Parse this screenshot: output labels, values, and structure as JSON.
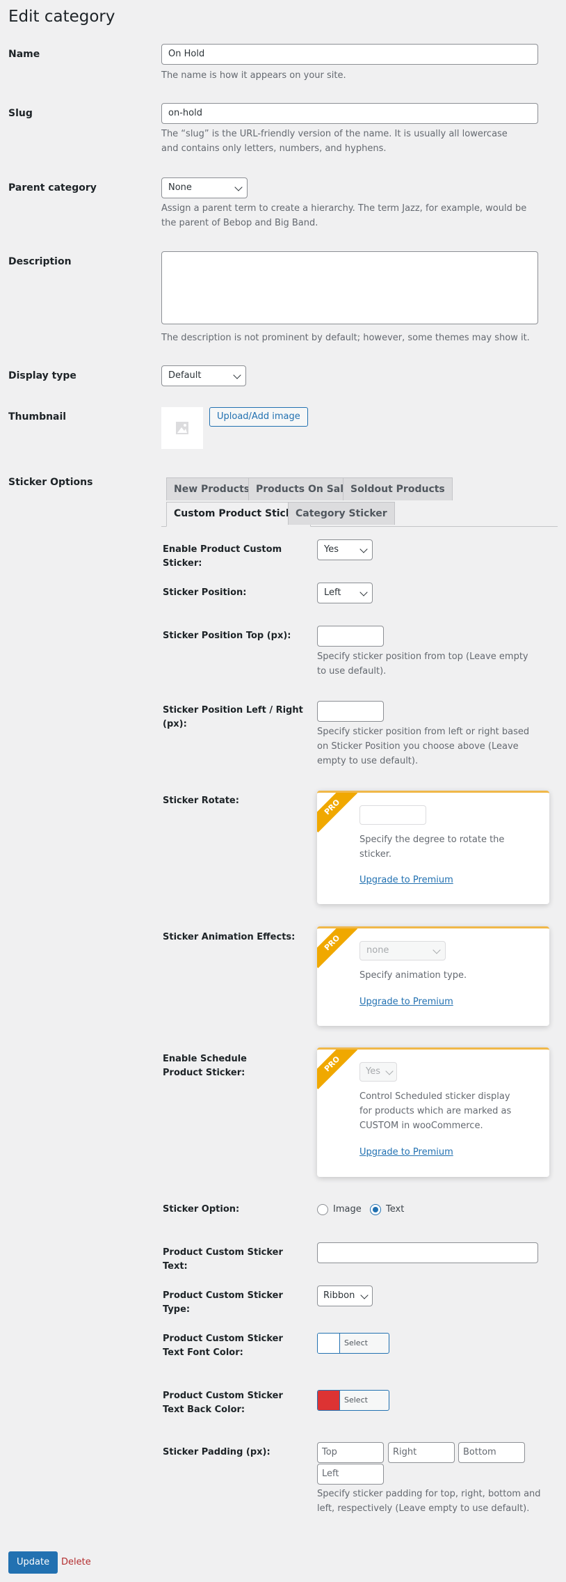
{
  "page_title": "Edit category",
  "fields": {
    "name": {
      "label": "Name",
      "value": "On Hold",
      "desc": "The name is how it appears on your site."
    },
    "slug": {
      "label": "Slug",
      "value": "on-hold",
      "desc": "The “slug” is the URL-friendly version of the name. It is usually all lowercase and contains only letters, numbers, and hyphens."
    },
    "parent": {
      "label": "Parent category",
      "value": "None",
      "desc": "Assign a parent term to create a hierarchy. The term Jazz, for example, would be the parent of Bebop and Big Band."
    },
    "description": {
      "label": "Description",
      "value": "",
      "desc": "The description is not prominent by default; however, some themes may show it."
    },
    "display_type": {
      "label": "Display type",
      "value": "Default"
    },
    "thumbnail": {
      "label": "Thumbnail",
      "button": "Upload/Add image"
    }
  },
  "sticker": {
    "label": "Sticker Options",
    "tabs": [
      "New Products",
      "Products On Sale",
      "Soldout Products",
      "Custom Product Sticker",
      "Category Sticker"
    ],
    "active_tab": "Custom Product Sticker",
    "enable": {
      "label": "Enable Product Custom Sticker:",
      "value": "Yes"
    },
    "position": {
      "label": "Sticker Position:",
      "value": "Left"
    },
    "top": {
      "label": "Sticker Position Top (px):",
      "value": "",
      "desc": "Specify sticker position from top (Leave empty to use default)."
    },
    "left_right": {
      "label": "Sticker Position Left / Right (px):",
      "value": "",
      "desc": "Specify sticker position from left or right based on Sticker Position you choose above (Leave empty to use default)."
    },
    "rotate": {
      "label": "Sticker Rotate:",
      "badge": "PRO",
      "value": "",
      "desc": "Specify the degree to rotate the sticker.",
      "link": "Upgrade to Premium"
    },
    "animation": {
      "label": "Sticker Animation Effects:",
      "badge": "PRO",
      "value": "none",
      "desc": "Specify animation type.",
      "link": "Upgrade to Premium"
    },
    "schedule": {
      "label": "Enable Schedule Product Sticker:",
      "badge": "PRO",
      "value": "Yes",
      "desc": "Control Scheduled sticker display for products which are marked as CUSTOM in wooCommerce.",
      "link": "Upgrade to Premium"
    },
    "option": {
      "label": "Sticker Option:",
      "choices": [
        "Image",
        "Text"
      ],
      "selected": "Text"
    },
    "text": {
      "label": "Product Custom Sticker Text:",
      "value": ""
    },
    "type": {
      "label": "Product Custom Sticker Type:",
      "value": "Ribbon"
    },
    "font_color": {
      "label": "Product Custom Sticker Text Font Color:",
      "button": "Select Color",
      "color": "#ffffff"
    },
    "back_color": {
      "label": "Product Custom Sticker Text Back Color:",
      "button": "Select Color",
      "color": "#dd3333"
    },
    "padding": {
      "label": "Sticker Padding (px):",
      "placeholders": [
        "Top",
        "Right",
        "Bottom",
        "Left"
      ],
      "desc": "Specify sticker padding for top, right, bottom and left, respectively (Leave empty to use default)."
    }
  },
  "actions": {
    "update": "Update",
    "delete": "Delete"
  },
  "colors": {
    "accent": "#2271b1",
    "pro": "#f0a800",
    "danger": "#b32d2e"
  }
}
